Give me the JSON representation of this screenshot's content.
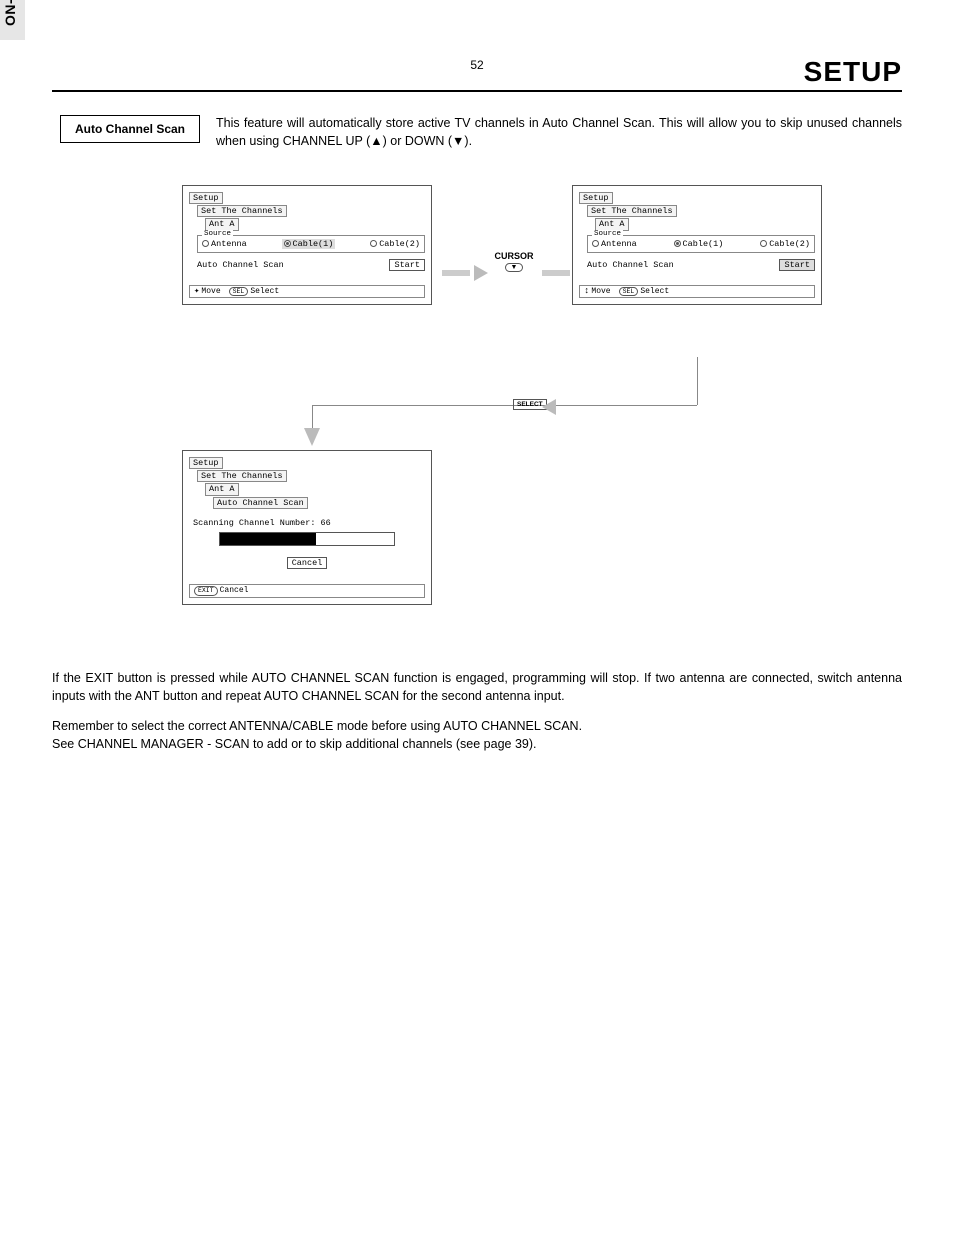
{
  "header": {
    "title": "SETUP"
  },
  "feature": {
    "label": "Auto Channel Scan",
    "desc": "This feature will automatically store active TV channels in Auto Channel Scan.  This will allow you to skip unused channels when using CHANNEL UP (▲) or DOWN (▼)."
  },
  "screens": {
    "common": {
      "crumb1": "Setup",
      "crumb2": "Set The Channels",
      "crumb3": "Ant A",
      "sourceLabel": "Source",
      "opts": {
        "antenna": "Antenna",
        "cable1": "Cable(1)",
        "cable2": "Cable(2)"
      },
      "acsLabel": "Auto Channel Scan",
      "startBtn": "Start",
      "hintMove": "Move",
      "hintSelPill": "SEL",
      "hintSelect": "Select"
    },
    "s3": {
      "crumb4": "Auto Channel Scan",
      "scanLine": "Scanning Channel Number: 66",
      "cancelBtn": "Cancel",
      "hintCancelPill": "EXIT",
      "hintCancel": "Cancel"
    }
  },
  "flow": {
    "cursorLabel": "CURSOR",
    "cursorKey": "▼",
    "selectKey": "SELECT"
  },
  "body": {
    "p1": "If the EXIT button is pressed while AUTO CHANNEL SCAN function is engaged, programming will stop.  If two antenna are connected, switch antenna inputs with the ANT button and repeat AUTO CHANNEL SCAN for the second antenna input.",
    "p2a": "Remember to select the correct ANTENNA/CABLE mode before using AUTO CHANNEL SCAN.",
    "p2b": "See CHANNEL MANAGER - SCAN to add or to skip additional channels (see page 39)."
  },
  "sidebar": {
    "label": "ON-SCREEN DISPLAY"
  },
  "pageNumber": "52"
}
